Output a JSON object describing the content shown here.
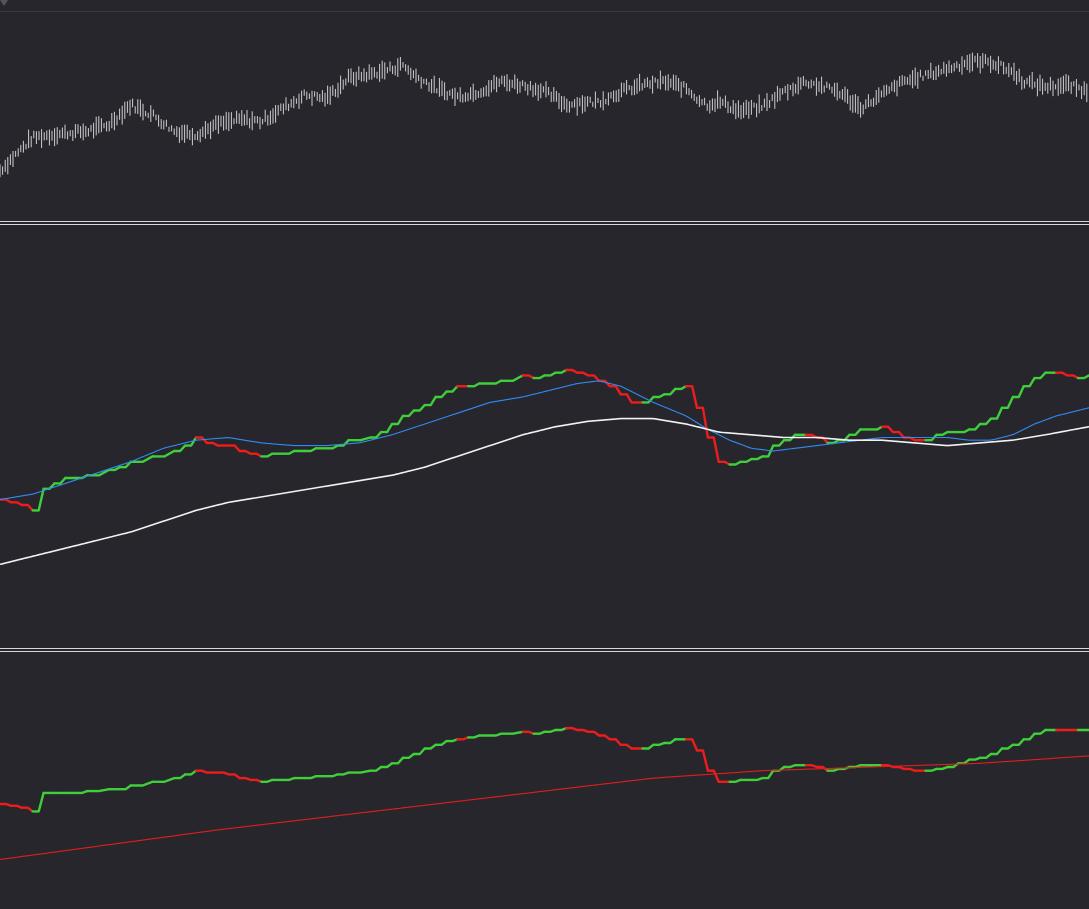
{
  "colors": {
    "background": "#27262c",
    "separator": "#d8d8d8",
    "price_bar": "#cfcfcf",
    "trend_up": "#3fcf3a",
    "trend_down": "#ee1c1c",
    "fast_ma": "#2f8cf0",
    "slow_ma": "#f2f2f2",
    "baseline": "#e01e1e"
  },
  "chart_data": [
    {
      "type": "line",
      "panel": "price",
      "grid": false,
      "x_range": [
        0,
        100
      ],
      "ylim": [
        0,
        100
      ],
      "series": [
        {
          "style": "ohlc-bars",
          "color_key": "price_bar",
          "x": [
            0,
            3,
            5,
            8,
            10,
            12,
            14,
            16,
            18,
            20,
            22,
            24,
            26,
            28,
            30,
            32,
            35,
            37,
            38,
            40,
            42,
            44,
            46,
            48,
            50,
            52,
            53,
            55,
            57,
            59,
            61,
            63,
            64,
            65,
            66,
            68,
            70,
            72,
            74,
            75,
            76,
            77,
            79,
            81,
            83,
            85,
            87,
            89,
            91,
            93,
            94,
            96,
            98,
            100
          ],
          "y": [
            22,
            42,
            44,
            46,
            50,
            62,
            56,
            46,
            44,
            50,
            53,
            52,
            60,
            68,
            66,
            78,
            82,
            86,
            80,
            72,
            67,
            70,
            76,
            74,
            70,
            62,
            63,
            64,
            70,
            74,
            76,
            72,
            66,
            62,
            64,
            58,
            61,
            70,
            76,
            74,
            72,
            70,
            60,
            68,
            76,
            80,
            84,
            88,
            88,
            82,
            76,
            73,
            74,
            70
          ]
        }
      ]
    },
    {
      "type": "line",
      "panel": "main",
      "grid": false,
      "x_range": [
        0,
        100
      ],
      "ylim": [
        0,
        100
      ],
      "series": [
        {
          "style": "stepped-trend",
          "color_key": "trend",
          "x": [
            0,
            1,
            2,
            3,
            4,
            5,
            6,
            7,
            8,
            10,
            11,
            12,
            14,
            16,
            17,
            18,
            19,
            20,
            21,
            22,
            23,
            24,
            25,
            26,
            27,
            28,
            29,
            30,
            31,
            32,
            34,
            35,
            36,
            37,
            38,
            39,
            40,
            41,
            42,
            43,
            44,
            45,
            46,
            48,
            49,
            50,
            51,
            52,
            53,
            54,
            55,
            56,
            57,
            58,
            59,
            60,
            61,
            62,
            63,
            64,
            65,
            66,
            67,
            68,
            69,
            70,
            71,
            72,
            73,
            74,
            75,
            76,
            77,
            78,
            79,
            80,
            81,
            82,
            83,
            84,
            85,
            86,
            87,
            88,
            89,
            90,
            91,
            92,
            93,
            94,
            95,
            96,
            97,
            98,
            99,
            100
          ],
          "y": [
            32,
            31,
            30,
            28,
            36,
            38,
            40,
            40,
            41,
            43,
            44,
            46,
            48,
            50,
            52,
            55,
            53,
            52,
            52,
            50,
            49,
            48,
            49,
            49,
            50,
            50,
            51,
            51,
            52,
            54,
            55,
            57,
            60,
            63,
            65,
            67,
            70,
            72,
            74,
            74,
            75,
            75,
            76,
            78,
            77,
            78,
            79,
            80,
            79,
            78,
            76,
            74,
            71,
            68,
            68,
            70,
            71,
            73,
            74,
            66,
            55,
            46,
            45,
            46,
            47,
            48,
            52,
            54,
            56,
            56,
            55,
            53,
            54,
            56,
            58,
            58,
            59,
            57,
            55,
            54,
            54,
            56,
            57,
            57,
            58,
            60,
            62,
            66,
            70,
            74,
            77,
            79,
            79,
            78,
            77,
            78
          ],
          "up": [
            0,
            0,
            0,
            0,
            1,
            1,
            1,
            1,
            1,
            1,
            1,
            1,
            1,
            1,
            1,
            1,
            0,
            0,
            0,
            0,
            0,
            0,
            1,
            1,
            1,
            1,
            1,
            1,
            1,
            1,
            1,
            1,
            1,
            1,
            1,
            1,
            1,
            1,
            1,
            0,
            1,
            1,
            1,
            1,
            0,
            1,
            1,
            1,
            0,
            0,
            0,
            0,
            0,
            0,
            0,
            1,
            1,
            1,
            1,
            0,
            0,
            0,
            0,
            1,
            1,
            1,
            1,
            1,
            1,
            1,
            0,
            0,
            1,
            1,
            1,
            1,
            1,
            0,
            0,
            0,
            0,
            1,
            1,
            1,
            1,
            1,
            1,
            1,
            1,
            1,
            1,
            1,
            1,
            0,
            0,
            1
          ]
        },
        {
          "style": "line",
          "color_key": "fast_ma",
          "x": [
            0,
            3,
            6,
            9,
            12,
            15,
            18,
            21,
            24,
            27,
            30,
            33,
            36,
            39,
            42,
            45,
            48,
            51,
            53,
            55,
            57,
            60,
            63,
            65,
            67,
            69,
            71,
            73,
            75,
            77,
            79,
            81,
            83,
            85,
            87,
            89,
            91,
            93,
            95,
            97,
            100
          ],
          "y": [
            32,
            34,
            38,
            42,
            46,
            51,
            54,
            55,
            53,
            52,
            52,
            53,
            56,
            60,
            64,
            68,
            70,
            73,
            75,
            76,
            74,
            68,
            63,
            58,
            54,
            51,
            50,
            51,
            52,
            53,
            54,
            55,
            55,
            55,
            55,
            54,
            54,
            56,
            60,
            63,
            66
          ]
        },
        {
          "style": "line",
          "color_key": "slow_ma",
          "x": [
            0,
            3,
            6,
            9,
            12,
            15,
            18,
            21,
            24,
            27,
            30,
            33,
            36,
            39,
            42,
            45,
            48,
            51,
            54,
            57,
            60,
            63,
            66,
            69,
            72,
            75,
            78,
            81,
            84,
            87,
            90,
            93,
            96,
            100
          ],
          "y": [
            8,
            11,
            14,
            17,
            20,
            24,
            28,
            31,
            33,
            35,
            37,
            39,
            41,
            44,
            48,
            52,
            56,
            59,
            61,
            62,
            62,
            60,
            57,
            56,
            55,
            55,
            54,
            54,
            53,
            52,
            53,
            54,
            56,
            59
          ]
        }
      ]
    },
    {
      "type": "line",
      "panel": "lower",
      "grid": false,
      "x_range": [
        0,
        100
      ],
      "ylim": [
        0,
        100
      ],
      "series": [
        {
          "style": "stepped-trend",
          "color_key": "trend",
          "x": [
            0,
            1,
            2,
            3,
            4,
            5,
            6,
            7,
            8,
            10,
            11,
            12,
            14,
            16,
            17,
            18,
            19,
            20,
            21,
            22,
            23,
            24,
            25,
            26,
            27,
            28,
            29,
            30,
            31,
            32,
            34,
            35,
            36,
            37,
            38,
            39,
            40,
            41,
            42,
            43,
            44,
            45,
            46,
            48,
            49,
            50,
            51,
            52,
            53,
            54,
            55,
            56,
            57,
            58,
            59,
            60,
            61,
            62,
            63,
            64,
            65,
            66,
            67,
            68,
            69,
            70,
            71,
            72,
            73,
            74,
            75,
            76,
            77,
            78,
            79,
            80,
            81,
            82,
            83,
            84,
            85,
            86,
            87,
            88,
            89,
            90,
            91,
            92,
            93,
            94,
            95,
            96,
            97,
            98,
            99,
            100
          ],
          "y": [
            40,
            39,
            38,
            36,
            46,
            46,
            46,
            46,
            47,
            48,
            48,
            50,
            52,
            54,
            56,
            58,
            57,
            57,
            56,
            54,
            53,
            52,
            53,
            53,
            54,
            54,
            55,
            55,
            56,
            57,
            58,
            60,
            62,
            65,
            67,
            70,
            72,
            74,
            75,
            76,
            77,
            77,
            78,
            79,
            78,
            79,
            80,
            81,
            80,
            79,
            77,
            75,
            72,
            70,
            70,
            72,
            73,
            75,
            75,
            69,
            58,
            52,
            52,
            53,
            53,
            54,
            58,
            60,
            61,
            61,
            60,
            58,
            59,
            60,
            61,
            61,
            61,
            60,
            59,
            58,
            58,
            59,
            60,
            62,
            64,
            65,
            67,
            70,
            72,
            75,
            78,
            80,
            80,
            80,
            80,
            80
          ],
          "up": [
            0,
            0,
            0,
            0,
            1,
            1,
            1,
            1,
            1,
            1,
            1,
            1,
            1,
            1,
            1,
            1,
            0,
            0,
            0,
            0,
            0,
            0,
            1,
            1,
            1,
            1,
            1,
            1,
            1,
            1,
            1,
            1,
            1,
            1,
            1,
            1,
            1,
            1,
            1,
            0,
            1,
            1,
            1,
            1,
            0,
            1,
            1,
            1,
            0,
            0,
            0,
            0,
            0,
            0,
            0,
            1,
            1,
            1,
            1,
            0,
            0,
            0,
            0,
            1,
            1,
            1,
            1,
            1,
            1,
            1,
            0,
            0,
            1,
            1,
            1,
            1,
            1,
            0,
            0,
            0,
            0,
            1,
            1,
            1,
            1,
            1,
            1,
            1,
            1,
            1,
            1,
            1,
            1,
            0,
            0,
            1
          ]
        },
        {
          "style": "line",
          "color_key": "baseline",
          "x": [
            0,
            10,
            20,
            30,
            40,
            50,
            60,
            70,
            80,
            90,
            100
          ],
          "y": [
            10,
            18,
            26,
            33,
            40,
            47,
            54,
            58,
            60,
            62,
            66
          ]
        }
      ]
    }
  ]
}
